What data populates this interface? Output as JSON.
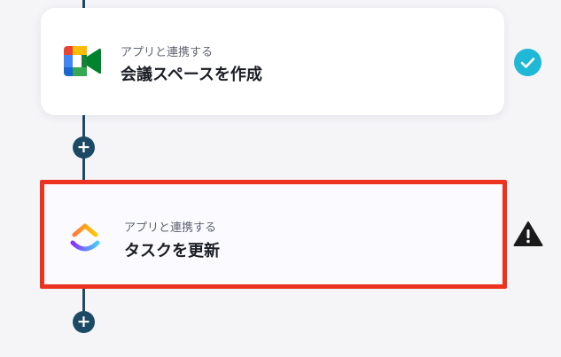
{
  "flow": {
    "steps": [
      {
        "caption": "アプリと連携する",
        "title": "会議スペースを作成",
        "app_icon": "google-meet-icon",
        "status": "check-circle-icon",
        "status_color": "#1fb8d6"
      },
      {
        "caption": "アプリと連携する",
        "title": "タスクを更新",
        "app_icon": "clickup-icon",
        "status": "warning-icon",
        "status_color": "#1a1a1a",
        "highlight_color": "#ec3320"
      }
    ],
    "add_step_icon": "plus-icon",
    "connector_color": "#1c4a64"
  }
}
